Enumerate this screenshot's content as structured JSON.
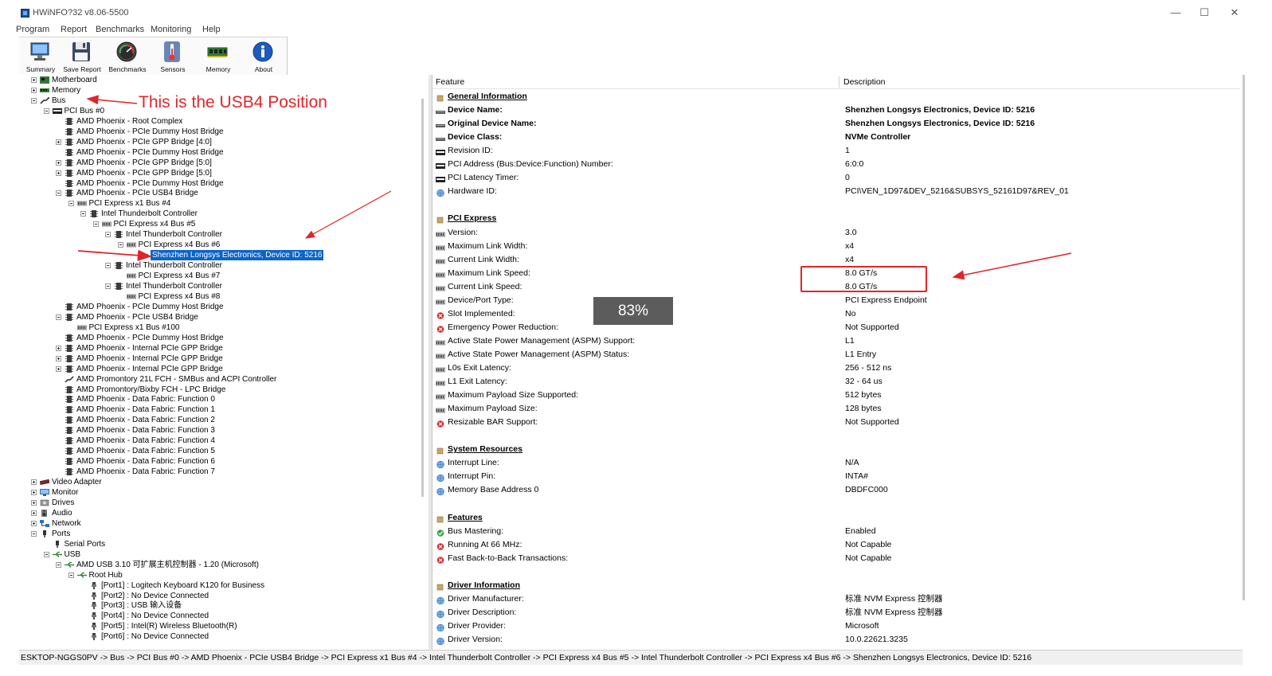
{
  "window": {
    "title": "HWiNFO?32 v8.06-5500",
    "controls": {
      "minimize": "—",
      "maximize": "☐",
      "close": "✕"
    }
  },
  "menu": [
    {
      "label": "Program"
    },
    {
      "label": "Report"
    },
    {
      "label": "Benchmarks"
    },
    {
      "label": "Monitoring"
    },
    {
      "label": "Help"
    }
  ],
  "toolbar": [
    {
      "label": "Summary",
      "icon": "monitor-icon"
    },
    {
      "label": "Save Report",
      "icon": "floppy-icon"
    },
    {
      "label": "Benchmarks",
      "icon": "gauge-icon"
    },
    {
      "label": "Sensors",
      "icon": "thermometer-icon"
    },
    {
      "label": "Memory",
      "icon": "memory-module-icon"
    },
    {
      "label": "About",
      "icon": "info-icon"
    }
  ],
  "tree": [
    {
      "label": "Motherboard",
      "icon": "motherboard-icon",
      "depth": 0,
      "expander": "plus"
    },
    {
      "label": "Memory",
      "icon": "memory-icon",
      "depth": 0,
      "expander": "plus"
    },
    {
      "label": "Bus",
      "icon": "bus-icon",
      "depth": 0,
      "expander": "minus"
    },
    {
      "label": "PCI Bus #0",
      "icon": "pci-icon",
      "depth": 1,
      "expander": "minus"
    },
    {
      "label": "AMD Phoenix - Root Complex",
      "icon": "chip-icon",
      "depth": 2,
      "expander": ""
    },
    {
      "label": "AMD Phoenix - PCIe Dummy Host Bridge",
      "icon": "chip-icon",
      "depth": 2,
      "expander": ""
    },
    {
      "label": "AMD Phoenix - PCIe GPP Bridge [4:0]",
      "icon": "chip-icon",
      "depth": 2,
      "expander": "plus"
    },
    {
      "label": "AMD Phoenix - PCIe Dummy Host Bridge",
      "icon": "chip-icon",
      "depth": 2,
      "expander": ""
    },
    {
      "label": "AMD Phoenix - PCIe GPP Bridge [5:0]",
      "icon": "chip-icon",
      "depth": 2,
      "expander": "plus"
    },
    {
      "label": "AMD Phoenix - PCIe GPP Bridge [5:0]",
      "icon": "chip-icon",
      "depth": 2,
      "expander": "plus"
    },
    {
      "label": "AMD Phoenix - PCIe Dummy Host Bridge",
      "icon": "chip-icon",
      "depth": 2,
      "expander": ""
    },
    {
      "label": "AMD Phoenix - PCIe USB4 Bridge",
      "icon": "chip-icon",
      "depth": 2,
      "expander": "minus"
    },
    {
      "label": "PCI Express x1 Bus #4",
      "icon": "pcie-icon",
      "depth": 3,
      "expander": "minus"
    },
    {
      "label": "Intel Thunderbolt Controller",
      "icon": "chip-icon",
      "depth": 4,
      "expander": "minus"
    },
    {
      "label": "PCI Express x4 Bus #5",
      "icon": "pcie-icon",
      "depth": 5,
      "expander": "minus"
    },
    {
      "label": "Intel Thunderbolt Controller",
      "icon": "chip-icon",
      "depth": 6,
      "expander": "minus"
    },
    {
      "label": "PCI Express x4 Bus #6",
      "icon": "pcie-icon",
      "depth": 7,
      "expander": "minus"
    },
    {
      "label": "Shenzhen Longsys Electronics, Device ID: 5216",
      "icon": "drive-icon",
      "depth": 8,
      "expander": "",
      "selected": true
    },
    {
      "label": "Intel Thunderbolt Controller",
      "icon": "chip-icon",
      "depth": 6,
      "expander": "minus"
    },
    {
      "label": "PCI Express x4 Bus #7",
      "icon": "pcie-icon",
      "depth": 7,
      "expander": ""
    },
    {
      "label": "Intel Thunderbolt Controller",
      "icon": "chip-icon",
      "depth": 6,
      "expander": "minus"
    },
    {
      "label": "PCI Express x4 Bus #8",
      "icon": "pcie-icon",
      "depth": 7,
      "expander": ""
    },
    {
      "label": "AMD Phoenix - PCIe Dummy Host Bridge",
      "icon": "chip-icon",
      "depth": 2,
      "expander": ""
    },
    {
      "label": "AMD Phoenix - PCIe USB4 Bridge",
      "icon": "chip-icon",
      "depth": 2,
      "expander": "minus"
    },
    {
      "label": "PCI Express x1 Bus #100",
      "icon": "pcie-icon",
      "depth": 3,
      "expander": ""
    },
    {
      "label": "AMD Phoenix - PCIe Dummy Host Bridge",
      "icon": "chip-icon",
      "depth": 2,
      "expander": ""
    },
    {
      "label": "AMD Phoenix - Internal PCIe GPP Bridge",
      "icon": "chip-icon",
      "depth": 2,
      "expander": "plus"
    },
    {
      "label": "AMD Phoenix - Internal PCIe GPP Bridge",
      "icon": "chip-icon",
      "depth": 2,
      "expander": "plus"
    },
    {
      "label": "AMD Phoenix - Internal PCIe GPP Bridge",
      "icon": "chip-icon",
      "depth": 2,
      "expander": "plus"
    },
    {
      "label": "AMD Promontory 21L FCH - SMBus and ACPI Controller",
      "icon": "smbus-icon",
      "depth": 2,
      "expander": ""
    },
    {
      "label": "AMD Promontory/Bixby FCH - LPC Bridge",
      "icon": "chip-icon",
      "depth": 2,
      "expander": ""
    },
    {
      "label": "AMD Phoenix - Data Fabric: Function 0",
      "icon": "chip-icon",
      "depth": 2,
      "expander": ""
    },
    {
      "label": "AMD Phoenix - Data Fabric: Function 1",
      "icon": "chip-icon",
      "depth": 2,
      "expander": ""
    },
    {
      "label": "AMD Phoenix - Data Fabric: Function 2",
      "icon": "chip-icon",
      "depth": 2,
      "expander": ""
    },
    {
      "label": "AMD Phoenix - Data Fabric: Function 3",
      "icon": "chip-icon",
      "depth": 2,
      "expander": ""
    },
    {
      "label": "AMD Phoenix - Data Fabric: Function 4",
      "icon": "chip-icon",
      "depth": 2,
      "expander": ""
    },
    {
      "label": "AMD Phoenix - Data Fabric: Function 5",
      "icon": "chip-icon",
      "depth": 2,
      "expander": ""
    },
    {
      "label": "AMD Phoenix - Data Fabric: Function 6",
      "icon": "chip-icon",
      "depth": 2,
      "expander": ""
    },
    {
      "label": "AMD Phoenix - Data Fabric: Function 7",
      "icon": "chip-icon",
      "depth": 2,
      "expander": ""
    },
    {
      "label": "Video Adapter",
      "icon": "gpu-icon",
      "depth": 0,
      "expander": "plus"
    },
    {
      "label": "Monitor",
      "icon": "monitor-icon",
      "depth": 0,
      "expander": "plus"
    },
    {
      "label": "Drives",
      "icon": "drives-icon",
      "depth": 0,
      "expander": "plus"
    },
    {
      "label": "Audio",
      "icon": "speaker-icon",
      "depth": 0,
      "expander": "plus"
    },
    {
      "label": "Network",
      "icon": "network-icon",
      "depth": 0,
      "expander": "plus"
    },
    {
      "label": "Ports",
      "icon": "port-icon",
      "depth": 0,
      "expander": "minus"
    },
    {
      "label": "Serial Ports",
      "icon": "port-icon",
      "depth": 1,
      "expander": ""
    },
    {
      "label": "USB",
      "icon": "usb-icon",
      "depth": 1,
      "expander": "minus"
    },
    {
      "label": "AMD USB 3.10 可扩展主机控制器 - 1.20 (Microsoft)",
      "icon": "usb-icon",
      "depth": 2,
      "expander": "minus"
    },
    {
      "label": "Root Hub",
      "icon": "usb-icon",
      "depth": 3,
      "expander": "minus"
    },
    {
      "label": "[Port1] : Logitech Keyboard K120 for Business",
      "icon": "usb-plug-icon",
      "depth": 4,
      "expander": ""
    },
    {
      "label": "[Port2] : No Device Connected",
      "icon": "usb-plug-icon",
      "depth": 4,
      "expander": ""
    },
    {
      "label": "[Port3] : USB 输入设备",
      "icon": "usb-plug-icon",
      "depth": 4,
      "expander": ""
    },
    {
      "label": "[Port4] : No Device Connected",
      "icon": "usb-plug-icon",
      "depth": 4,
      "expander": ""
    },
    {
      "label": "[Port5] : Intel(R) Wireless Bluetooth(R)",
      "icon": "usb-plug-icon",
      "depth": 4,
      "expander": ""
    },
    {
      "label": "[Port6] : No Device Connected",
      "icon": "usb-plug-icon",
      "depth": 4,
      "expander": ""
    }
  ],
  "details": {
    "header_feature": "Feature",
    "header_description": "Description",
    "rows": [
      {
        "type": "section",
        "label": "General Information",
        "value": "",
        "icon": "section-bullet-icon"
      },
      {
        "type": "bold",
        "label": "Device Name:",
        "value": "Shenzhen Longsys Electronics, Device ID: 5216",
        "icon": "drive-icon"
      },
      {
        "type": "bold",
        "label": "Original Device Name:",
        "value": "Shenzhen Longsys Electronics, Device ID: 5216",
        "icon": "drive-icon"
      },
      {
        "type": "bold",
        "label": "Device Class:",
        "value": "NVMe Controller",
        "icon": "drive-icon"
      },
      {
        "type": "row",
        "label": "Revision ID:",
        "value": "1",
        "icon": "pci-icon"
      },
      {
        "type": "row",
        "label": "PCI Address (Bus:Device:Function) Number:",
        "value": "6:0:0",
        "icon": "pci-icon"
      },
      {
        "type": "row",
        "label": "PCI Latency Timer:",
        "value": "0",
        "icon": "pci-icon"
      },
      {
        "type": "row",
        "label": "Hardware ID:",
        "value": "PCI\\VEN_1D97&DEV_5216&SUBSYS_52161D97&REV_01",
        "icon": "globe-icon"
      },
      {
        "type": "blank",
        "label": "",
        "value": "",
        "icon": ""
      },
      {
        "type": "section",
        "label": "PCI Express",
        "value": "",
        "icon": "section-bullet-icon"
      },
      {
        "type": "row",
        "label": "Version:",
        "value": "3.0",
        "icon": "pcie-icon"
      },
      {
        "type": "row",
        "label": "Maximum Link Width:",
        "value": "x4",
        "icon": "pcie-icon"
      },
      {
        "type": "row",
        "label": "Current Link Width:",
        "value": "x4",
        "icon": "pcie-icon"
      },
      {
        "type": "row",
        "label": "Maximum Link Speed:",
        "value": "8.0 GT/s",
        "icon": "pcie-icon"
      },
      {
        "type": "row",
        "label": "Current Link Speed:",
        "value": "8.0 GT/s",
        "icon": "pcie-icon"
      },
      {
        "type": "row",
        "label": "Device/Port Type:",
        "value": "PCI Express Endpoint",
        "icon": "pcie-icon"
      },
      {
        "type": "row",
        "label": "Slot Implemented:",
        "value": "No",
        "icon": "red-x-icon"
      },
      {
        "type": "row",
        "label": "Emergency Power Reduction:",
        "value": "Not Supported",
        "icon": "red-x-icon"
      },
      {
        "type": "row",
        "label": "Active State Power Management (ASPM) Support:",
        "value": "L1",
        "icon": "pcie-icon"
      },
      {
        "type": "row",
        "label": "Active State Power Management (ASPM) Status:",
        "value": "L1 Entry",
        "icon": "pcie-icon"
      },
      {
        "type": "row",
        "label": "L0s Exit Latency:",
        "value": "256 - 512 ns",
        "icon": "pcie-icon"
      },
      {
        "type": "row",
        "label": "L1 Exit Latency:",
        "value": "32 - 64 us",
        "icon": "pcie-icon"
      },
      {
        "type": "row",
        "label": "Maximum Payload Size Supported:",
        "value": "512 bytes",
        "icon": "pcie-icon"
      },
      {
        "type": "row",
        "label": "Maximum Payload Size:",
        "value": "128 bytes",
        "icon": "pcie-icon"
      },
      {
        "type": "row",
        "label": "Resizable BAR Support:",
        "value": "Not Supported",
        "icon": "red-x-icon"
      },
      {
        "type": "blank",
        "label": "",
        "value": "",
        "icon": ""
      },
      {
        "type": "section",
        "label": "System Resources",
        "value": "",
        "icon": "section-bullet-icon"
      },
      {
        "type": "row",
        "label": "Interrupt Line:",
        "value": "N/A",
        "icon": "globe-icon"
      },
      {
        "type": "row",
        "label": "Interrupt Pin:",
        "value": "INTA#",
        "icon": "globe-icon"
      },
      {
        "type": "row",
        "label": "Memory Base Address 0",
        "value": "DBDFC000",
        "icon": "globe-icon"
      },
      {
        "type": "blank",
        "label": "",
        "value": "",
        "icon": ""
      },
      {
        "type": "section",
        "label": "Features",
        "value": "",
        "icon": "section-bullet-icon"
      },
      {
        "type": "row",
        "label": "Bus Mastering:",
        "value": "Enabled",
        "icon": "green-check-icon"
      },
      {
        "type": "row",
        "label": "Running At 66 MHz:",
        "value": "Not Capable",
        "icon": "red-x-icon"
      },
      {
        "type": "row",
        "label": "Fast Back-to-Back Transactions:",
        "value": "Not Capable",
        "icon": "red-x-icon"
      },
      {
        "type": "blank",
        "label": "",
        "value": "",
        "icon": ""
      },
      {
        "type": "section",
        "label": "Driver Information",
        "value": "",
        "icon": "section-bullet-icon"
      },
      {
        "type": "row",
        "label": "Driver Manufacturer:",
        "value": "标准 NVM Express 控制器",
        "icon": "globe-icon"
      },
      {
        "type": "row",
        "label": "Driver Description:",
        "value": "标准 NVM Express 控制器",
        "icon": "globe-icon"
      },
      {
        "type": "row",
        "label": "Driver Provider:",
        "value": "Microsoft",
        "icon": "globe-icon"
      },
      {
        "type": "row",
        "label": "Driver Version:",
        "value": "10.0.22621.3235",
        "icon": "globe-icon"
      }
    ]
  },
  "status_bar": {
    "path": "ESKTOP-NGGS0PV -> Bus -> PCI Bus #0 -> AMD Phoenix - PCIe USB4 Bridge -> PCI Express x1 Bus #4 -> Intel Thunderbolt Controller -> PCI Express x4 Bus #5 -> Intel Thunderbolt Controller -> PCI Express x4 Bus #6 -> Shenzhen Longsys Electronics, Device ID: 5216"
  },
  "overlays": {
    "annotation": "This is the USB4 Position",
    "percent_badge": "83%",
    "annotation_color": "#e0242b"
  }
}
